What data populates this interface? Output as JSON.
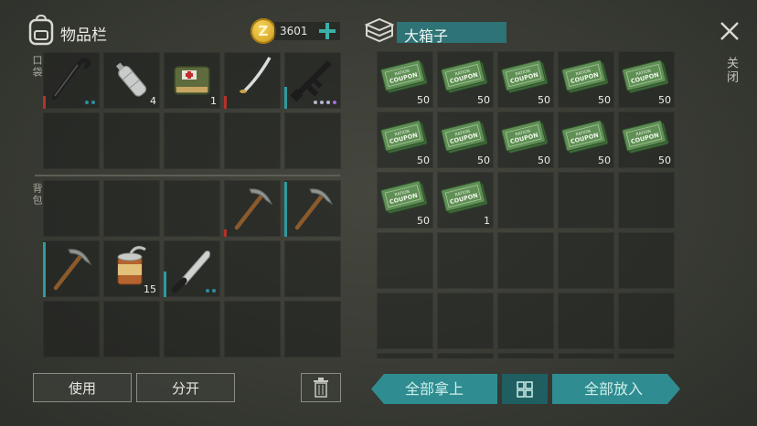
{
  "inventory": {
    "title": "物品栏",
    "currency": "3601",
    "currency_icon_letter": "Z",
    "pocket_label": "口袋",
    "backpack_label": "背包",
    "pocket_slots": [
      {
        "item": "crowbar",
        "qty": "",
        "durability": "red",
        "dots": [
          "#2f8ca0",
          "#2f8ca0"
        ]
      },
      {
        "item": "water-bottle",
        "qty": "4"
      },
      {
        "item": "medkit-bag",
        "qty": "1"
      },
      {
        "item": "katana",
        "qty": "",
        "durability": "red"
      },
      {
        "item": "assault-rifle",
        "qty": "",
        "durability": "teal",
        "dots": [
          "#b4b4cc",
          "#b4b4cc",
          "#b4b4cc",
          "#a86ae0"
        ]
      }
    ],
    "backpack_slots": [
      {
        "item": "pickaxe",
        "qty": "",
        "durability": "red",
        "slot": 3
      },
      {
        "item": "pickaxe",
        "qty": "",
        "durability": "teal",
        "slot": 4
      },
      {
        "item": "pickaxe",
        "qty": "",
        "durability": "teal",
        "slot": 5
      },
      {
        "item": "canned-food",
        "qty": "15",
        "slot": 6
      },
      {
        "item": "machete",
        "qty": "",
        "durability": "teal",
        "dots": [
          "#2f8ca0",
          "#2f8ca0"
        ],
        "slot": 7
      }
    ]
  },
  "box": {
    "title": "大箱子",
    "coupon_text_1": "RATION",
    "coupon_text_2": "COUPON",
    "coupons": [
      "50",
      "50",
      "50",
      "50",
      "50",
      "50",
      "50",
      "50",
      "50",
      "50",
      "50",
      "1"
    ]
  },
  "buttons": {
    "use": "使用",
    "split": "分开",
    "take_all": "全部拿上",
    "put_all": "全部放入"
  },
  "close": {
    "label": "关闭"
  },
  "colors": {
    "teal": "#2f8c90",
    "durability_red": "#b2332b",
    "durability_teal": "#2f9aa0"
  }
}
